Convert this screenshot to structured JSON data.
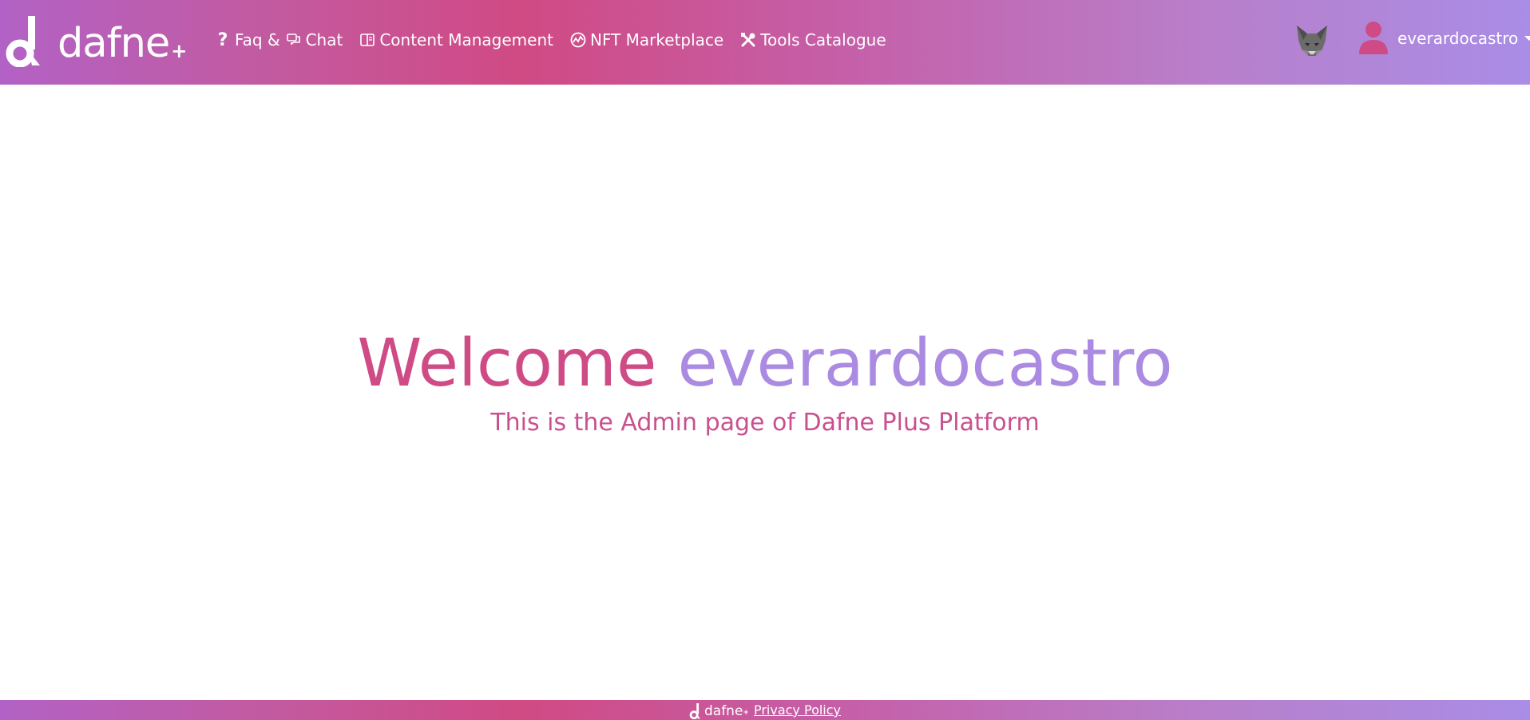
{
  "brand": {
    "name": "dafne",
    "plus": "+"
  },
  "nav": {
    "items": [
      {
        "label": "Faq &",
        "icon": "question-icon"
      },
      {
        "label": "Chat",
        "icon": "chat-icon"
      },
      {
        "label": "Content Management",
        "icon": "book-icon"
      },
      {
        "label": "NFT Marketplace",
        "icon": "chart-circle-icon"
      },
      {
        "label": "Tools Catalogue",
        "icon": "tools-icon"
      }
    ]
  },
  "wallet": {
    "icon": "metamask-fox-icon"
  },
  "user": {
    "name": "everardocastro",
    "icon": "user-icon"
  },
  "main": {
    "welcome_word": "Welcome",
    "welcome_user": "everardocastro",
    "subtitle": "This is the Admin page of Dafne Plus Platform"
  },
  "footer": {
    "brand_name": "dafne",
    "brand_plus": "+",
    "privacy_label": "Privacy Policy"
  },
  "colors": {
    "pink": "#cf4b86",
    "lavender": "#ab8be2",
    "gradient_start": "#b262c6",
    "gradient_mid": "#d04a84",
    "gradient_end": "#a98de6"
  }
}
